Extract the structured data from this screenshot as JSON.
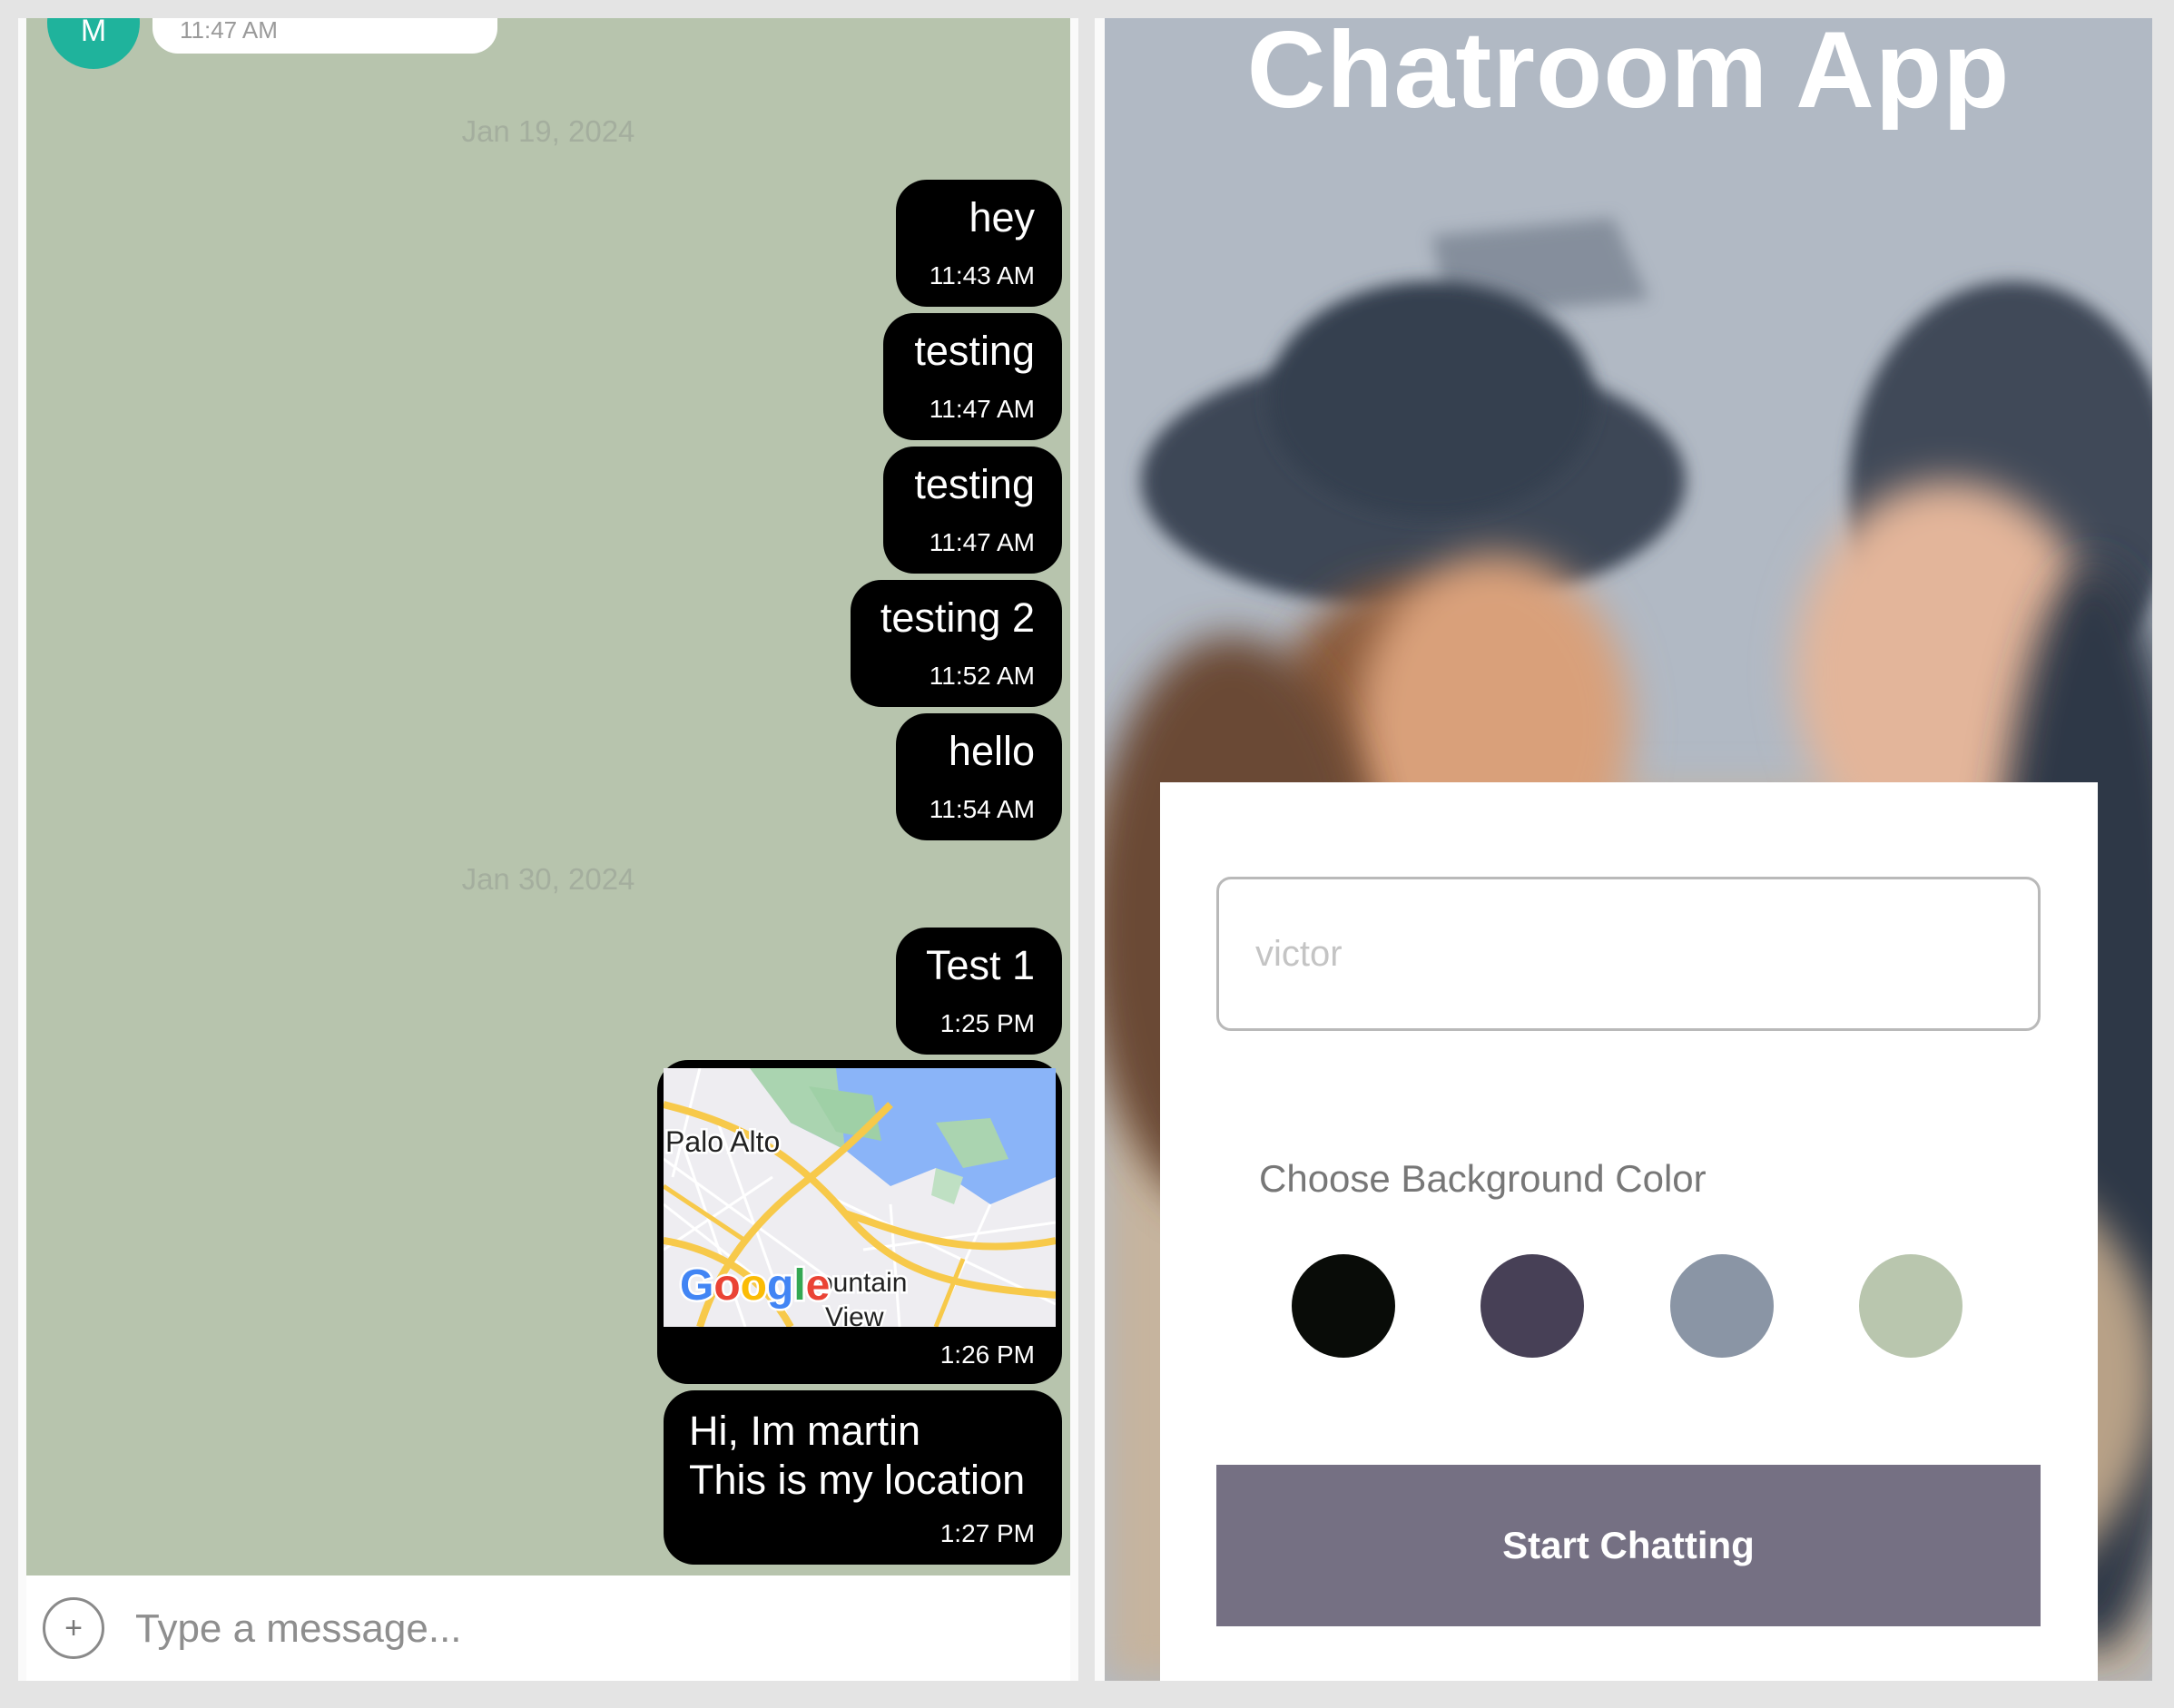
{
  "chat": {
    "avatar_initial": "M",
    "top_bubble_time": "11:47 AM",
    "date_separators": [
      "Jan 19, 2024",
      "Jan 30, 2024"
    ],
    "messages": [
      {
        "text": "hey",
        "time": "11:43 AM"
      },
      {
        "text": "testing",
        "time": "11:47 AM"
      },
      {
        "text": "testing",
        "time": "11:47 AM"
      },
      {
        "text": "testing 2",
        "time": "11:52 AM"
      },
      {
        "text": "hello",
        "time": "11:54 AM"
      },
      {
        "text": "Test 1",
        "time": "1:25 PM"
      },
      {
        "type": "location-map",
        "time": "1:26 PM",
        "map_labels": {
          "city_1": "Palo Alto",
          "city_2": "ountain",
          "city_2_line2": "View",
          "brand": "Google"
        }
      },
      {
        "text_line1": "Hi, Im martin",
        "text_line2": "This is my location",
        "time": "1:27 PM"
      }
    ],
    "background_color": "#b7c4ad",
    "bubble_color": "#000000",
    "input_placeholder": "Type a message...",
    "attach_icon": "plus-circle-icon"
  },
  "start_screen": {
    "title": "Chatroom App",
    "name_input_placeholder": "victor",
    "color_label": "Choose Background Color",
    "color_options": [
      "#090c08",
      "#474056",
      "#8a95a5",
      "#b9c6ae"
    ],
    "start_button_label": "Start Chatting",
    "start_button_color": "#757083"
  }
}
